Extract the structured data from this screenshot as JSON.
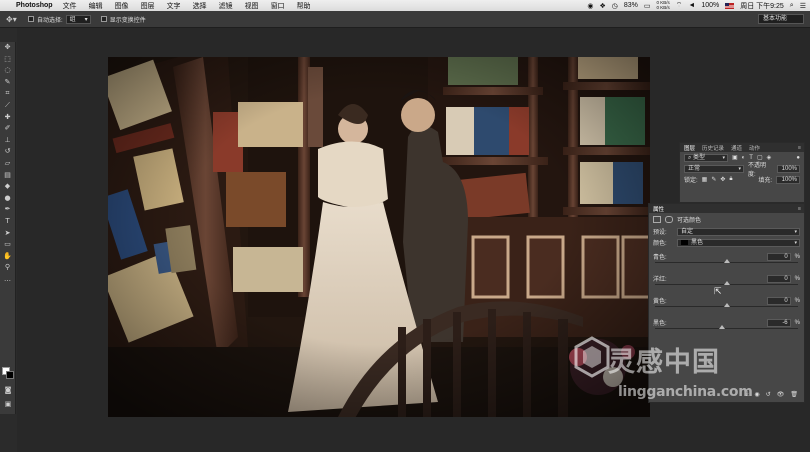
{
  "menubar": {
    "app_name": "Photoshop",
    "items": [
      "文件",
      "编辑",
      "图像",
      "图层",
      "文字",
      "选择",
      "滤镜",
      "视图",
      "窗口",
      "帮助"
    ],
    "battery": "83%",
    "net_up": "0 KB/s",
    "net_down": "0 KB/s",
    "zoom": "100%",
    "datetime": "周日 下午9:25"
  },
  "optbar": {
    "auto_select_label": "自动选择:",
    "auto_select_value": "组",
    "show_transform_label": "显示变换控件",
    "workspace": "基本功能"
  },
  "layers_panel": {
    "tabs": [
      "图层",
      "历史记录",
      "通道",
      "动作"
    ],
    "kind_filter": "类型",
    "blend_mode": "正常",
    "opacity_label": "不透明度:",
    "opacity_value": "100%",
    "lock_label": "锁定:",
    "fill_label": "填充:",
    "fill_value": "100%"
  },
  "properties_panel": {
    "title": "属性",
    "adjustment_name": "可选颜色",
    "preset_label": "预设:",
    "preset_value": "自定",
    "colors_label": "颜色:",
    "colors_value": "黑色",
    "cyan_label": "青色:",
    "cyan_value": "0",
    "magenta_label": "洋红:",
    "magenta_value": "0",
    "yellow_label": "黄色:",
    "yellow_value": "0",
    "black_label": "黑色:",
    "black_value": "-6",
    "sliders_fraction": [
      0.5,
      0.5,
      0.5,
      0.47
    ]
  },
  "watermark": {
    "brand_cn": "灵感中国",
    "url": "lingganchina.com"
  },
  "colors": {
    "accent": "#2a6bd6",
    "panel_bg": "#474747"
  }
}
